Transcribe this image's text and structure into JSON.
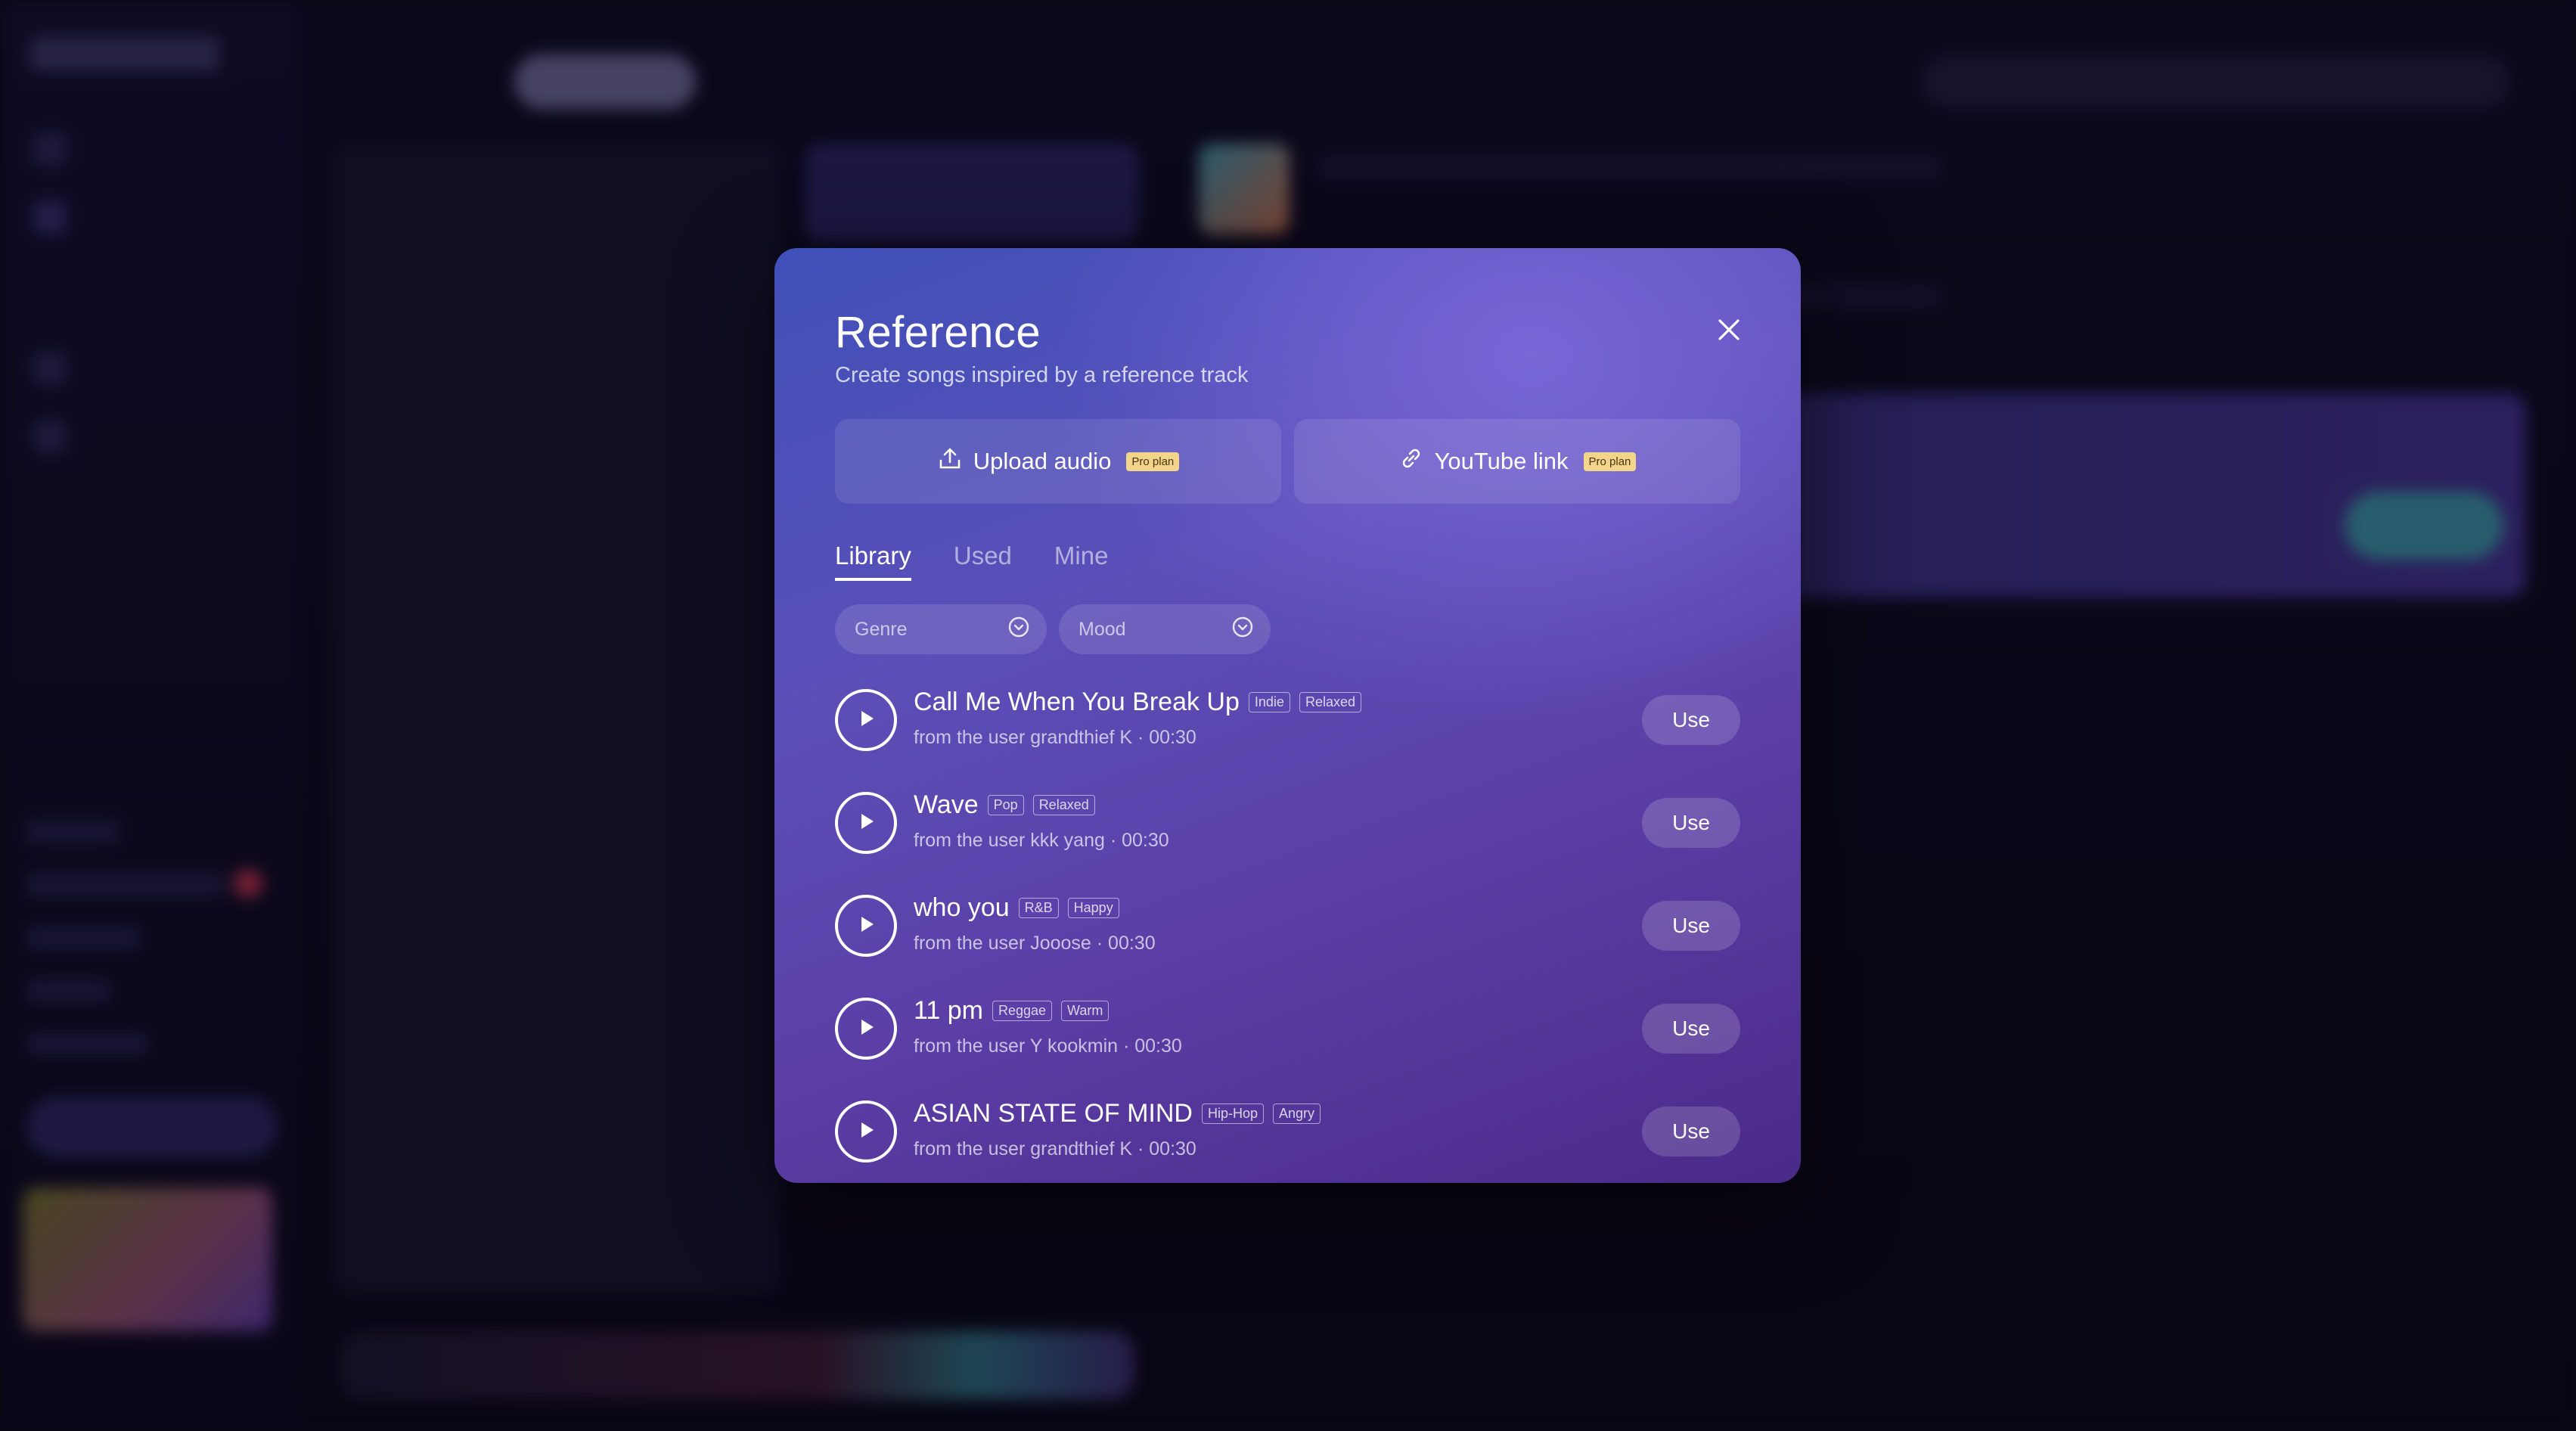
{
  "modal": {
    "title": "Reference",
    "subtitle": "Create songs inspired by a reference track",
    "upload": {
      "label": "Upload audio",
      "badge": "Pro plan"
    },
    "youtube": {
      "label": "YouTube link",
      "badge": "Pro plan"
    },
    "tabs": [
      {
        "label": "Library",
        "active": true
      },
      {
        "label": "Used",
        "active": false
      },
      {
        "label": "Mine",
        "active": false
      }
    ],
    "filters": {
      "genre": "Genre",
      "mood": "Mood"
    },
    "use_label": "Use",
    "tracks": [
      {
        "title": "Call Me When You Break Up",
        "tags": [
          "Indie",
          "Relaxed"
        ],
        "meta": "from the user grandthief K · 00:30"
      },
      {
        "title": "Wave",
        "tags": [
          "Pop",
          "Relaxed"
        ],
        "meta": "from the user kkk yang · 00:30"
      },
      {
        "title": "who you",
        "tags": [
          "R&B",
          "Happy"
        ],
        "meta": "from the user Jooose · 00:30"
      },
      {
        "title": "11 pm",
        "tags": [
          "Reggae",
          "Warm"
        ],
        "meta": "from the user Y kookmin · 00:30"
      },
      {
        "title": "ASIAN STATE OF MIND",
        "tags": [
          "Hip-Hop",
          "Angry"
        ],
        "meta": "from the user grandthief K · 00:30"
      }
    ]
  },
  "colors": {
    "badge": "#f2d48a",
    "modal_top": "#3f50b8",
    "modal_bottom": "#4a2a88"
  }
}
